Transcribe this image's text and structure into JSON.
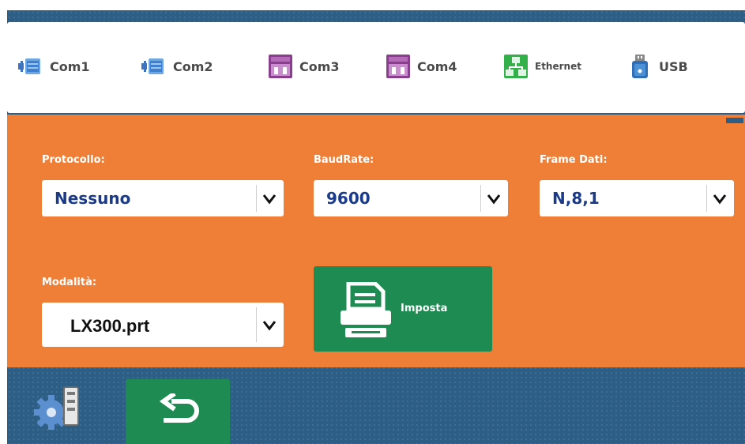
{
  "tabs": [
    {
      "label": "Com1",
      "icon": "serial-port-icon"
    },
    {
      "label": "Com2",
      "icon": "serial-port-icon"
    },
    {
      "label": "Com3",
      "icon": "rs485-port-icon"
    },
    {
      "label": "Com4",
      "icon": "rs485-port-icon"
    },
    {
      "label": "Ethernet",
      "icon": "network-icon"
    },
    {
      "label": "USB",
      "icon": "usb-drive-icon"
    }
  ],
  "settings": {
    "protocollo": {
      "label": "Protocollo:",
      "value": "Nessuno"
    },
    "baudrate": {
      "label": "BaudRate:",
      "value": "9600"
    },
    "frame_dati": {
      "label": "Frame Dati:",
      "value": "N,8,1"
    },
    "modalita": {
      "label": "Modalità:",
      "value": "LX300.prt"
    }
  },
  "actions": {
    "imposta_label": "Imposta",
    "imposta_icon": "printer-icon",
    "settings_icon": "gear-icon",
    "back_icon": "back-arrow-icon"
  },
  "colors": {
    "background": "#2c5e86",
    "panel": "#ef7f36",
    "button_green": "#1e8c52",
    "value_text": "#1a3a8a"
  }
}
